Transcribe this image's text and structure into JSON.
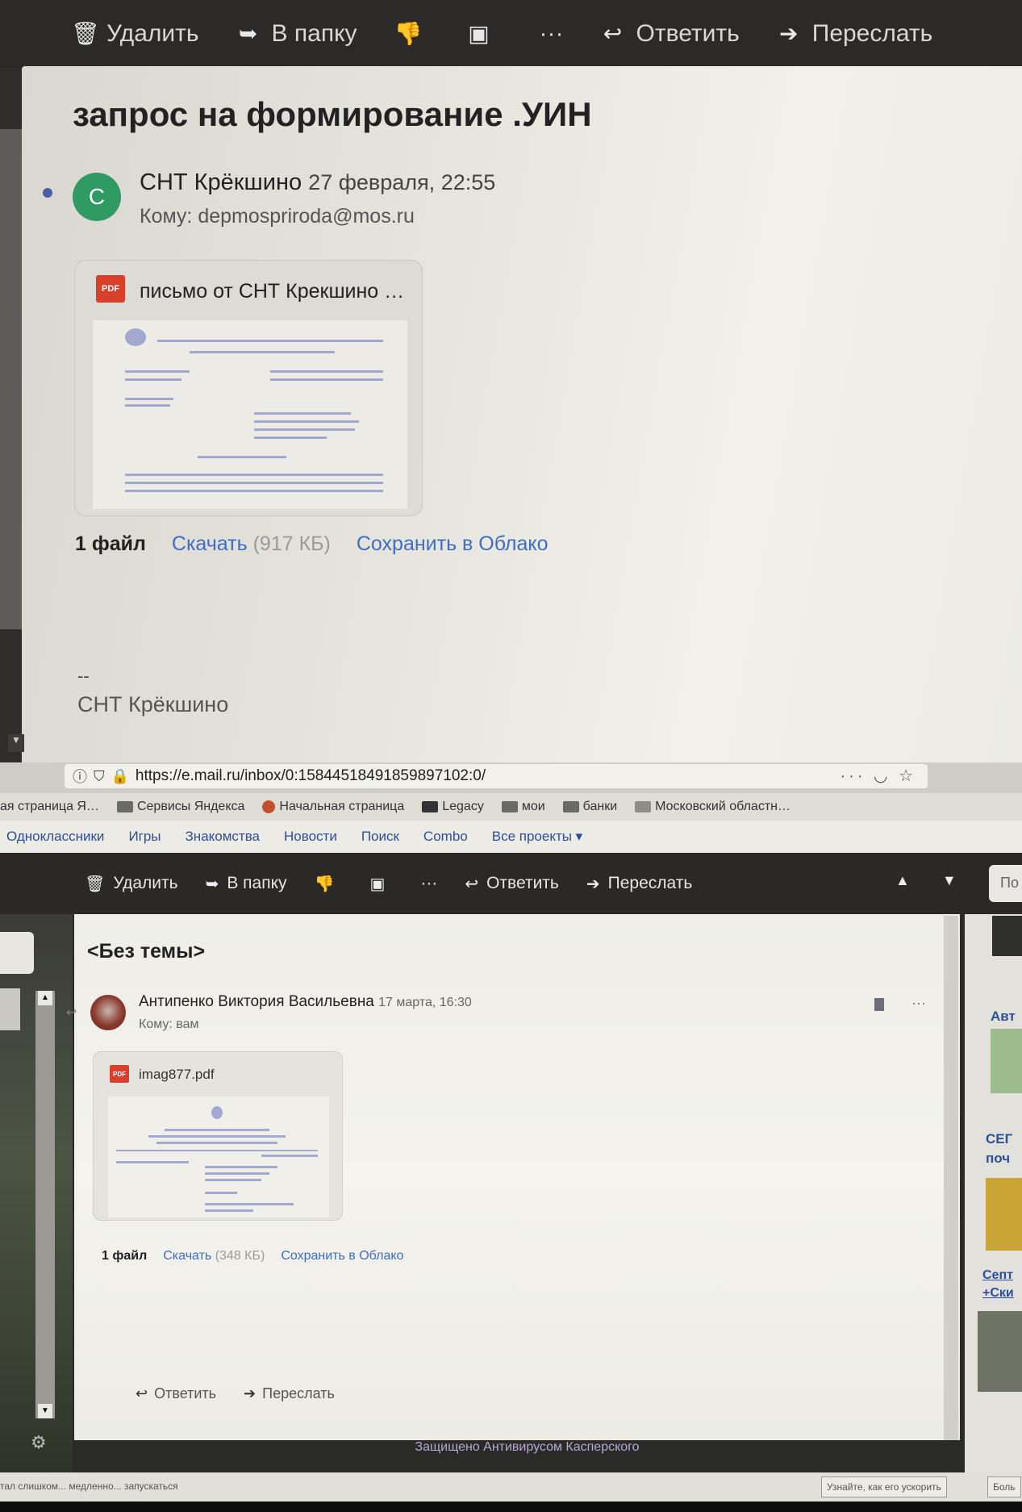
{
  "top": {
    "toolbar": {
      "delete_label": "Удалить",
      "move_label": "В папку",
      "more_label": "···",
      "reply_label": "Ответить",
      "forward_label": "Переслать"
    },
    "email": {
      "subject": "запрос на формирование .УИН",
      "avatar_letter": "С",
      "sender": "СНТ Крёкшино",
      "date": "27 февраля, 22:55",
      "to": "Кому: depmospriroda@mos.ru",
      "attachment_name": "письмо от СНТ Крекшино …",
      "files_count": "1 файл",
      "download_label": "Скачать",
      "download_size": "(917 КБ)",
      "save_cloud_label": "Сохранить в Облако",
      "signature_dash": "--",
      "signature": "СНТ Крёкшино"
    }
  },
  "bottom": {
    "url": "https://e.mail.ru/inbox/0:15844518491859897102:0/",
    "url_menu": "···",
    "bookmarks": [
      "ая страница Я…",
      "Сервисы Яндекса",
      "Начальная страница",
      "Legacy",
      "мои",
      "банки",
      "Московский областн…"
    ],
    "portal_links": [
      "Одноклассники",
      "Игры",
      "Знакомства",
      "Новости",
      "Поиск",
      "Combo",
      "Все проекты ▾"
    ],
    "toolbar": {
      "delete_label": "Удалить",
      "move_label": "В папку",
      "more_label": "···",
      "reply_label": "Ответить",
      "forward_label": "Переслать"
    },
    "search_stub": "По",
    "email": {
      "subject": "<Без темы>",
      "sender": "Антипенко Виктория Васильевна",
      "date": "17 марта, 16:30",
      "to": "Кому: вам",
      "more_label": "···",
      "attachment_name": "imag877.pdf",
      "files_count": "1 файл",
      "download_label": "Скачать",
      "download_size": "(348 КБ)",
      "save_cloud_label": "Сохранить в Облако",
      "reply_label": "Ответить",
      "forward_label": "Переслать"
    },
    "kaspersky": "Защищено Антивирусом Касперского",
    "status_left": "тал слишком... медленно... запускаться",
    "status_button": "Узнайте, как его ускорить",
    "status_button2": "Боль",
    "ads": {
      "ad1": "Авт",
      "ad2_line1": "СЕГ",
      "ad2_line2": "поч",
      "ad3_line1": "Септ",
      "ad3_line2": "+Ски"
    }
  },
  "colors": {
    "avatar_green": "#2f9a63",
    "link_blue": "#3b6ec8",
    "pdf_red": "#d9402c",
    "toolbar_dark": "#2b2a28"
  }
}
